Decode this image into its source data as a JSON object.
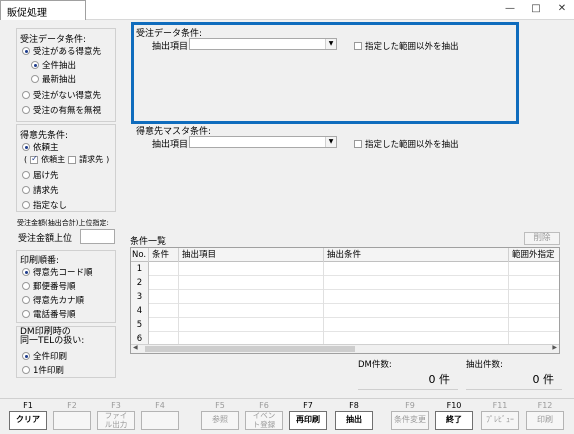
{
  "window": {
    "title": "販促処理",
    "controls": [
      "—",
      "□",
      "✕"
    ]
  },
  "left": {
    "order_data_group": {
      "title": "受注データ条件:",
      "options": [
        {
          "label": "受注がある得意先",
          "selected": true
        },
        {
          "label": "全件抽出",
          "selected": true
        },
        {
          "label": "最新抽出",
          "selected": false
        },
        {
          "label": "受注がない得意先",
          "selected": false
        },
        {
          "label": "受注の有無を無視",
          "selected": false
        }
      ]
    },
    "customer_group": {
      "title": "得意先条件:",
      "client_label": "依頼主",
      "sub_open": "(",
      "sub_client": "依頼主",
      "sub_billing": "請求先",
      "sub_close": ")",
      "delivery": "届け先",
      "billing": "請求先",
      "none": "指定なし"
    },
    "amount_note": "受注金額(抽出合計)上位指定:",
    "amount_label": "受注金額上位",
    "print_order": {
      "title": "印刷順番:",
      "options": [
        {
          "label": "得意先コード順",
          "selected": true
        },
        {
          "label": "郵便番号順",
          "selected": false
        },
        {
          "label": "得意先カナ順",
          "selected": false
        },
        {
          "label": "電話番号順",
          "selected": false
        }
      ]
    },
    "dm_group": {
      "title_line1": "DM印刷時の",
      "title_line2": "同一TELの扱い:",
      "options": [
        {
          "label": "全件印刷",
          "selected": true
        },
        {
          "label": "1件印刷",
          "selected": false
        }
      ]
    }
  },
  "main": {
    "order_cond_title": "受注データ条件:",
    "order_field_label": "抽出項目",
    "order_field_value": "",
    "order_exclude_label": "指定した範囲以外を抽出",
    "master_cond_title": "得意先マスタ条件:",
    "master_field_label": "抽出項目",
    "master_field_value": "",
    "master_exclude_label": "指定した範囲以外を抽出",
    "list_title": "条件一覧",
    "delete_button": "削除",
    "columns": [
      "No.",
      "条件",
      "抽出項目",
      "抽出条件",
      "範囲外指定"
    ],
    "rows": [
      "1",
      "2",
      "3",
      "4",
      "5",
      "6"
    ],
    "dm_count_label": "DM件数:",
    "dm_count_value": "0 件",
    "extract_count_label": "抽出件数:",
    "extract_count_value": "0 件"
  },
  "fkeys": [
    {
      "key": "F1",
      "label": "クリア",
      "active": true
    },
    {
      "key": "F2",
      "label": "",
      "active": false
    },
    {
      "key": "F3",
      "label": "ファイル出力",
      "active": false
    },
    {
      "key": "F4",
      "label": "",
      "active": false
    },
    {
      "key": "F5",
      "label": "参照",
      "active": false
    },
    {
      "key": "F6",
      "label": "イベント登録",
      "active": false
    },
    {
      "key": "F7",
      "label": "再印刷",
      "active": true
    },
    {
      "key": "F8",
      "label": "抽出",
      "active": true
    },
    {
      "key": "F9",
      "label": "条件変更",
      "active": false
    },
    {
      "key": "F10",
      "label": "終了",
      "active": true
    },
    {
      "key": "F11",
      "label": "ﾌﾟﾚﾋﾞｭｰ",
      "active": false
    },
    {
      "key": "F12",
      "label": "印刷",
      "active": false
    }
  ]
}
